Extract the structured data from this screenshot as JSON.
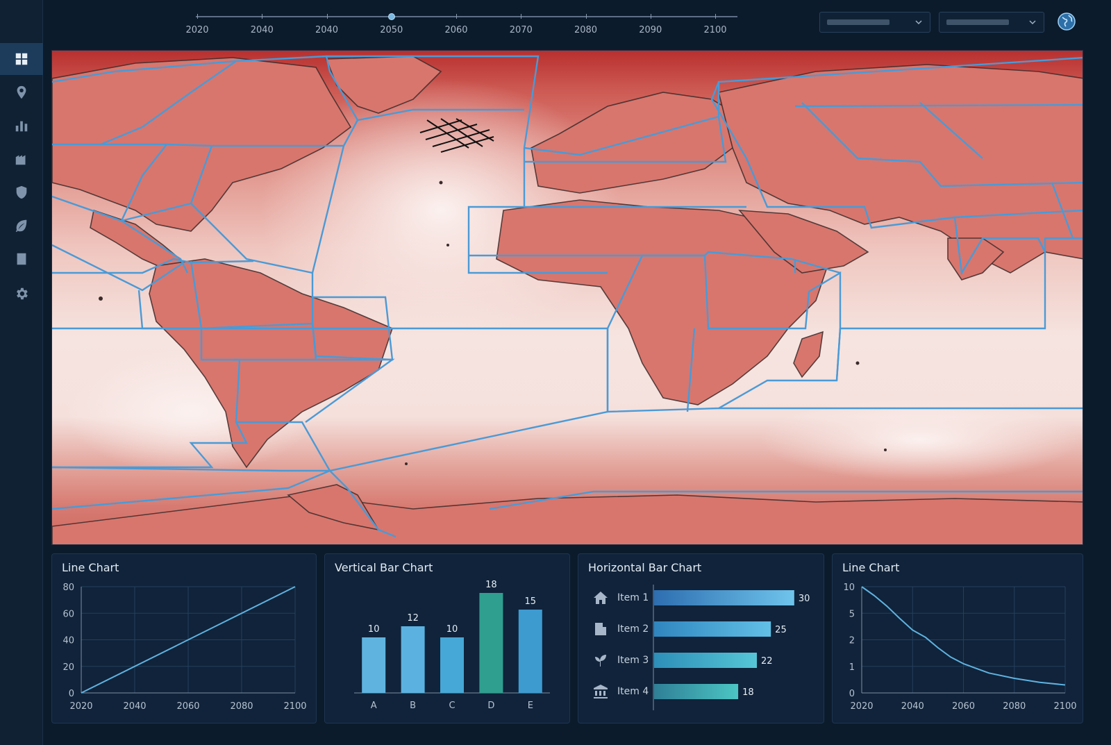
{
  "sidebar": {
    "items": [
      {
        "icon": "grid-icon",
        "active": true
      },
      {
        "icon": "map-pin-icon",
        "active": false
      },
      {
        "icon": "bar-chart-icon",
        "active": false
      },
      {
        "icon": "building-icon",
        "active": false
      },
      {
        "icon": "shield-icon",
        "active": false
      },
      {
        "icon": "leaf-icon",
        "active": false
      },
      {
        "icon": "document-icon",
        "active": false
      },
      {
        "icon": "gear-icon",
        "active": false
      }
    ]
  },
  "timeline": {
    "labels": [
      "2020",
      "2040",
      "2040",
      "2050",
      "2060",
      "2070",
      "2080",
      "2090",
      "2100"
    ],
    "selected": "2050"
  },
  "header": {
    "dropdown1_value": "",
    "dropdown2_value": "",
    "globe_icon": "globe-icon"
  },
  "colors": {
    "accent": "#4ea3d8",
    "map_warm": "#c84a44",
    "map_light": "#f7ebe9",
    "region_border": "#4a9ad6"
  },
  "panels": {
    "line1_title": "Line Chart",
    "vbar_title": "Vertical Bar Chart",
    "hbar_title": "Horizontal Bar Chart",
    "line2_title": "Line Chart"
  },
  "chart_data": [
    {
      "type": "line",
      "title": "Line Chart",
      "x": [
        2020,
        2100
      ],
      "y": [
        0,
        80
      ],
      "xticks": [
        "2020",
        "2040",
        "2060",
        "2080",
        "2100"
      ],
      "yticks": [
        "0",
        "20",
        "40",
        "60",
        "80"
      ],
      "xlim": [
        2020,
        2100
      ],
      "ylim": [
        0,
        80
      ],
      "grid": true
    },
    {
      "type": "bar",
      "title": "Vertical Bar Chart",
      "categories": [
        "A",
        "B",
        "C",
        "D",
        "E"
      ],
      "values": [
        10,
        12,
        10,
        18,
        15
      ],
      "ylim": [
        0,
        20
      ]
    },
    {
      "type": "bar",
      "title": "Horizontal Bar Chart",
      "orientation": "horizontal",
      "categories": [
        "Item 1",
        "Item 2",
        "Item 3",
        "Item 4"
      ],
      "icons": [
        "house-icon",
        "office-building-icon",
        "plant-icon",
        "bank-icon"
      ],
      "values": [
        30,
        25,
        22,
        18
      ],
      "xlim": [
        0,
        33
      ]
    },
    {
      "type": "line",
      "title": "Line Chart",
      "x": [
        2020,
        2025,
        2030,
        2035,
        2040,
        2045,
        2050,
        2055,
        2060,
        2070,
        2080,
        2090,
        2100
      ],
      "y": [
        10,
        8.3,
        6.3,
        4.4,
        3.1,
        2.3,
        1.7,
        1.35,
        1.1,
        0.75,
        0.55,
        0.4,
        0.3
      ],
      "xticks": [
        "2020",
        "2040",
        "2060",
        "2080",
        "2100"
      ],
      "yticks": [
        "0",
        "1",
        "2",
        "5",
        "10"
      ],
      "xlim": [
        2020,
        2100
      ],
      "grid": true
    }
  ]
}
